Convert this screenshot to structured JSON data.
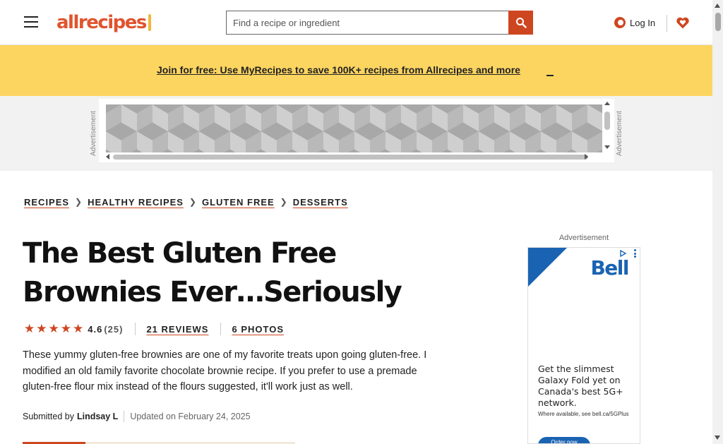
{
  "colors": {
    "brand": "#ce4620",
    "banner": "#fcd560",
    "ad_blue": "#1a63b2"
  },
  "header": {
    "logo_text": "allrecipes",
    "search": {
      "placeholder": "Find a recipe or ingredient",
      "value": ""
    },
    "login_label": "Log In",
    "icons": [
      "menu-icon",
      "search-icon",
      "user-icon",
      "heart-icon"
    ]
  },
  "promo": {
    "text": "Join for free: Use MyRecipes to save 100K+ recipes from Allrecipes and more"
  },
  "ad_band": {
    "label": "Advertisement"
  },
  "breadcrumb": [
    {
      "label": "RECIPES"
    },
    {
      "label": "HEALTHY RECIPES"
    },
    {
      "label": "GLUTEN FREE"
    },
    {
      "label": "DESSERTS"
    }
  ],
  "recipe": {
    "title": "The Best Gluten Free Brownies Ever…Seriously",
    "rating": {
      "value": "4.6",
      "stars": 4.5,
      "count": "(25)"
    },
    "reviews_label": "21 REVIEWS",
    "photos_label": "6 PHOTOS",
    "description": "These yummy gluten-free brownies are one of my favorite treats upon going gluten-free. I modified an old family favorite chocolate brownie recipe. If you prefer to use a premade gluten-free flour mix instead of the flours suggested, it'll work just as well.",
    "submitted_prefix": "Submitted by",
    "author": "Lindsay L",
    "updated": "Updated on February 24, 2025",
    "read_progress": 0.23
  },
  "side_ad": {
    "label": "Advertisement",
    "brand": "Bell",
    "headline": "Get the slimmest Galaxy Fold yet on Canada's best 5G+ network.",
    "fine_print": "Where available, see bell.ca/5GPlus",
    "cta": "Order now"
  }
}
